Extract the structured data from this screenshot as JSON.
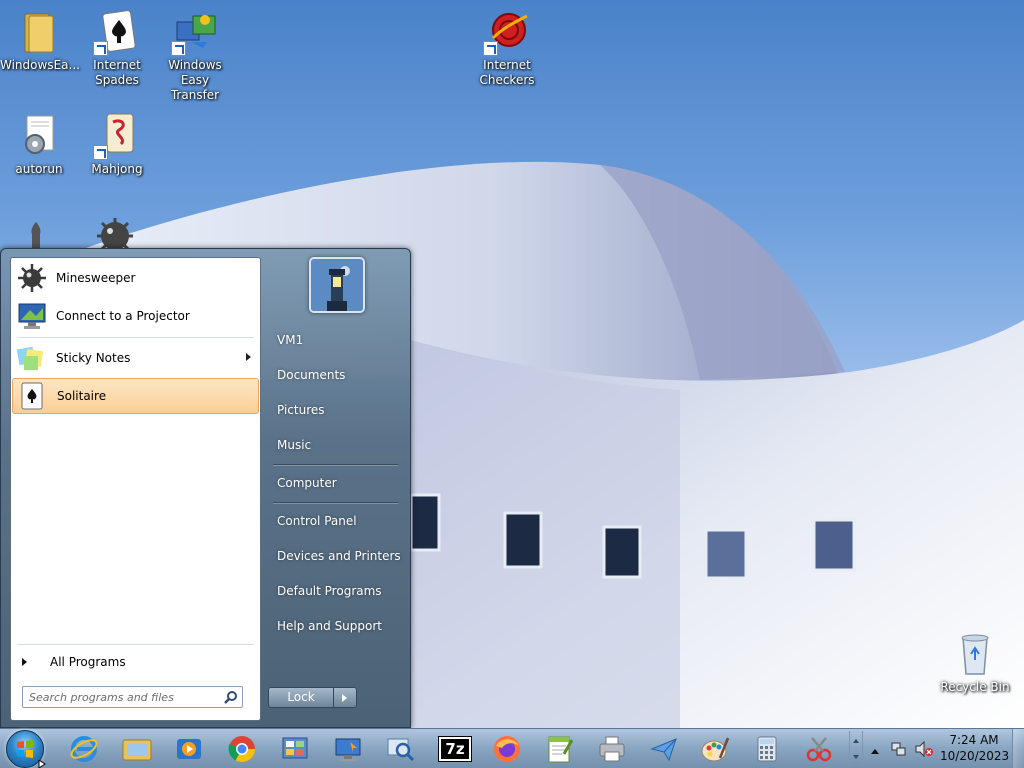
{
  "desktop": {
    "icons": [
      {
        "label": "WindowsEa...",
        "icon": "folder-icon"
      },
      {
        "label": "Internet Spades",
        "icon": "spades-icon"
      },
      {
        "label": "Windows Easy Transfer",
        "icon": "easy-transfer-icon"
      },
      {
        "label": "Internet Checkers",
        "icon": "checkers-icon"
      },
      {
        "label": "autorun",
        "icon": "settings-file-icon"
      },
      {
        "label": "Mahjong",
        "icon": "mahjong-icon"
      },
      {
        "label": "Recycle Bin",
        "icon": "recycle-bin-icon"
      }
    ]
  },
  "start_menu": {
    "programs": [
      {
        "label": "Minesweeper",
        "icon": "minesweeper-icon"
      },
      {
        "label": "Connect to a Projector",
        "icon": "projector-icon"
      },
      {
        "label": "Sticky Notes",
        "icon": "sticky-notes-icon"
      },
      {
        "label": "Solitaire",
        "icon": "solitaire-icon",
        "selected": true
      }
    ],
    "all_programs": "All Programs",
    "search_placeholder": "Search programs and files",
    "right_items": [
      "VM1",
      "Documents",
      "Pictures",
      "Music",
      "Computer",
      "Control Panel",
      "Devices and Printers",
      "Default Programs",
      "Help and Support"
    ],
    "lock_label": "Lock"
  },
  "taskbar": {
    "apps": [
      "internet-explorer-icon",
      "file-explorer-icon",
      "media-player-icon",
      "chrome-icon",
      "control-panel-icon",
      "remote-desktop-icon",
      "search-magnifier-icon",
      "7zip-icon",
      "firefox-icon",
      "notepad-plus-icon",
      "printer-icon",
      "send-icon",
      "paint-icon",
      "calculator-icon",
      "snipping-tool-icon"
    ],
    "seven_zip_label": "7z",
    "clock": {
      "time": "7:24 AM",
      "date": "10/20/2023"
    },
    "accent": "#2f86c9"
  }
}
